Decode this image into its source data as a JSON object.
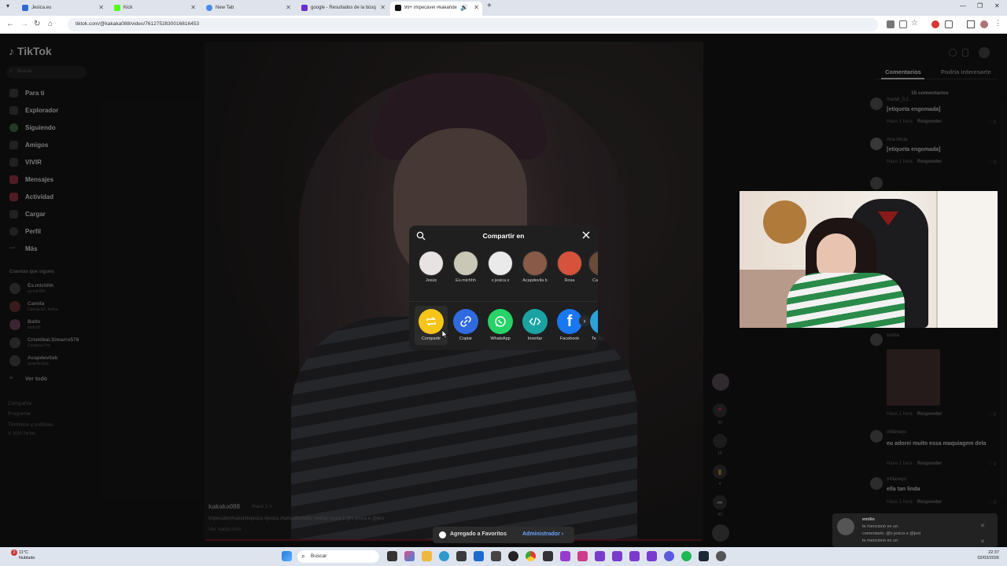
{
  "browser": {
    "tabs": [
      {
        "title": "Jesica.eu",
        "color": "#2b6bd6"
      },
      {
        "title": "Kick",
        "color": "#53fc18"
      },
      {
        "title": "New Tab",
        "color": "#4a8ae8"
      },
      {
        "title": "google - Resultados de la búsq",
        "color": "#6b2bd6"
      },
      {
        "title": "99+ Impecável #kakahde",
        "color": "#111111"
      }
    ],
    "url": "tiktok.com/@kakaka088/video/7612752830016816453"
  },
  "sidebar": {
    "logo": "TikTok",
    "search_placeholder": "Buscar",
    "nav": [
      {
        "label": "Para ti",
        "icon": "home-icon"
      },
      {
        "label": "Explorador",
        "icon": "compass-icon"
      },
      {
        "label": "Siguiendo",
        "icon": "following-icon"
      },
      {
        "label": "Amigos",
        "icon": "friends-icon"
      },
      {
        "label": "VIVIR",
        "icon": "live-icon"
      },
      {
        "label": "Mensajes",
        "icon": "messages-icon"
      },
      {
        "label": "Actividad",
        "icon": "activity-icon"
      },
      {
        "label": "Cargar",
        "icon": "upload-icon"
      },
      {
        "label": "Perfil",
        "icon": "profile-icon"
      },
      {
        "label": "Más",
        "icon": "more-icon"
      }
    ],
    "following_title": "Cuentas que sigues",
    "following": [
      {
        "name": "Es.michhh",
        "user": "es.michhh"
      },
      {
        "name": "Camila",
        "user": "Camila En Jesica"
      },
      {
        "name": "Balto",
        "user": "balto00"
      },
      {
        "name": "Cristóbal.Simarro578",
        "user": "Cristóbal Pré"
      },
      {
        "name": "Acapdevilab",
        "user": "acapdevilab"
      }
    ],
    "see_all": "Ver todo",
    "footer": [
      "Compañía",
      "Programa",
      "Términos y políticas",
      "© 2026 TikTok"
    ]
  },
  "video": {
    "username": "kakaka088",
    "time": "Hace 1 h",
    "description": "Impecable#kakahdejesica #jesica #tattooltbshotts #editar #para ti @s jesica e @jesi",
    "translate": "Ver traducción"
  },
  "actions": [
    {
      "name": "avatar",
      "count": ""
    },
    {
      "name": "like-icon",
      "count": "93"
    },
    {
      "name": "comment-icon",
      "count": "15"
    },
    {
      "name": "bookmark-icon",
      "count": "4"
    },
    {
      "name": "share-icon",
      "count": "43"
    },
    {
      "name": "music-disc-icon",
      "count": ""
    }
  ],
  "comments": {
    "tabs": [
      "Comentarios",
      "Podría interesarte"
    ],
    "count_label": "15 comentarios",
    "reply_label": "Responder",
    "items": [
      {
        "user": "maddi_0.2",
        "text": "[etiqueta engomada]",
        "meta": "Hace 1 hora",
        "likes": "0"
      },
      {
        "user": "Ana Alicia",
        "text": "[etiqueta engomada]",
        "meta": "Hace 1 hora",
        "likes": "0"
      },
      {
        "user": "sssha",
        "text": "",
        "meta": "Hace 1 hora",
        "likes": "0"
      },
      {
        "user": "millanays",
        "text": "eu adorei muito essa maquiagem dela",
        "meta": "Hace 1 hora",
        "likes": "0"
      },
      {
        "user": "millanays",
        "text": "ella tan linda",
        "meta": "Hace 1 hora",
        "likes": "0"
      }
    ]
  },
  "share_modal": {
    "title": "Compartir en",
    "friends": [
      "Jesús",
      "Es.michhh",
      "s jesica s",
      "Acapdevila b",
      "Rosa",
      "Ca"
    ],
    "friend_colors": [
      "#e8e2e2",
      "#c9c7b5",
      "#eaeaea",
      "#8a5a48",
      "#d7523a",
      "#6a4a3a"
    ],
    "targets": [
      {
        "label": "Compartir",
        "color": "#f5c518",
        "icon": "repost-icon"
      },
      {
        "label": "Copiar",
        "color": "#2f6ae0",
        "icon": "link-icon"
      },
      {
        "label": "WhatsApp",
        "color": "#25d366",
        "icon": "whatsapp-icon"
      },
      {
        "label": "Insertar",
        "color": "#1aa3a3",
        "icon": "embed-icon"
      },
      {
        "label": "Facebook",
        "color": "#1877f2",
        "icon": "facebook-icon"
      },
      {
        "label": "Te",
        "color": "#2aa1da",
        "icon": "telegram-icon"
      }
    ]
  },
  "toast": {
    "text": "Agregado a Favoritos",
    "action": "Administrador"
  },
  "notification": {
    "user": "emilio",
    "lines": [
      "te mencionó en un",
      "comentario: @s jesica e @jesi",
      "te mencionó en un"
    ]
  },
  "taskbar": {
    "weather_temp": "11°C",
    "weather_desc": "Nublado",
    "weather_badge": "2",
    "search_label": "Buscar",
    "time": "22:37",
    "date": "02/03/2026"
  }
}
